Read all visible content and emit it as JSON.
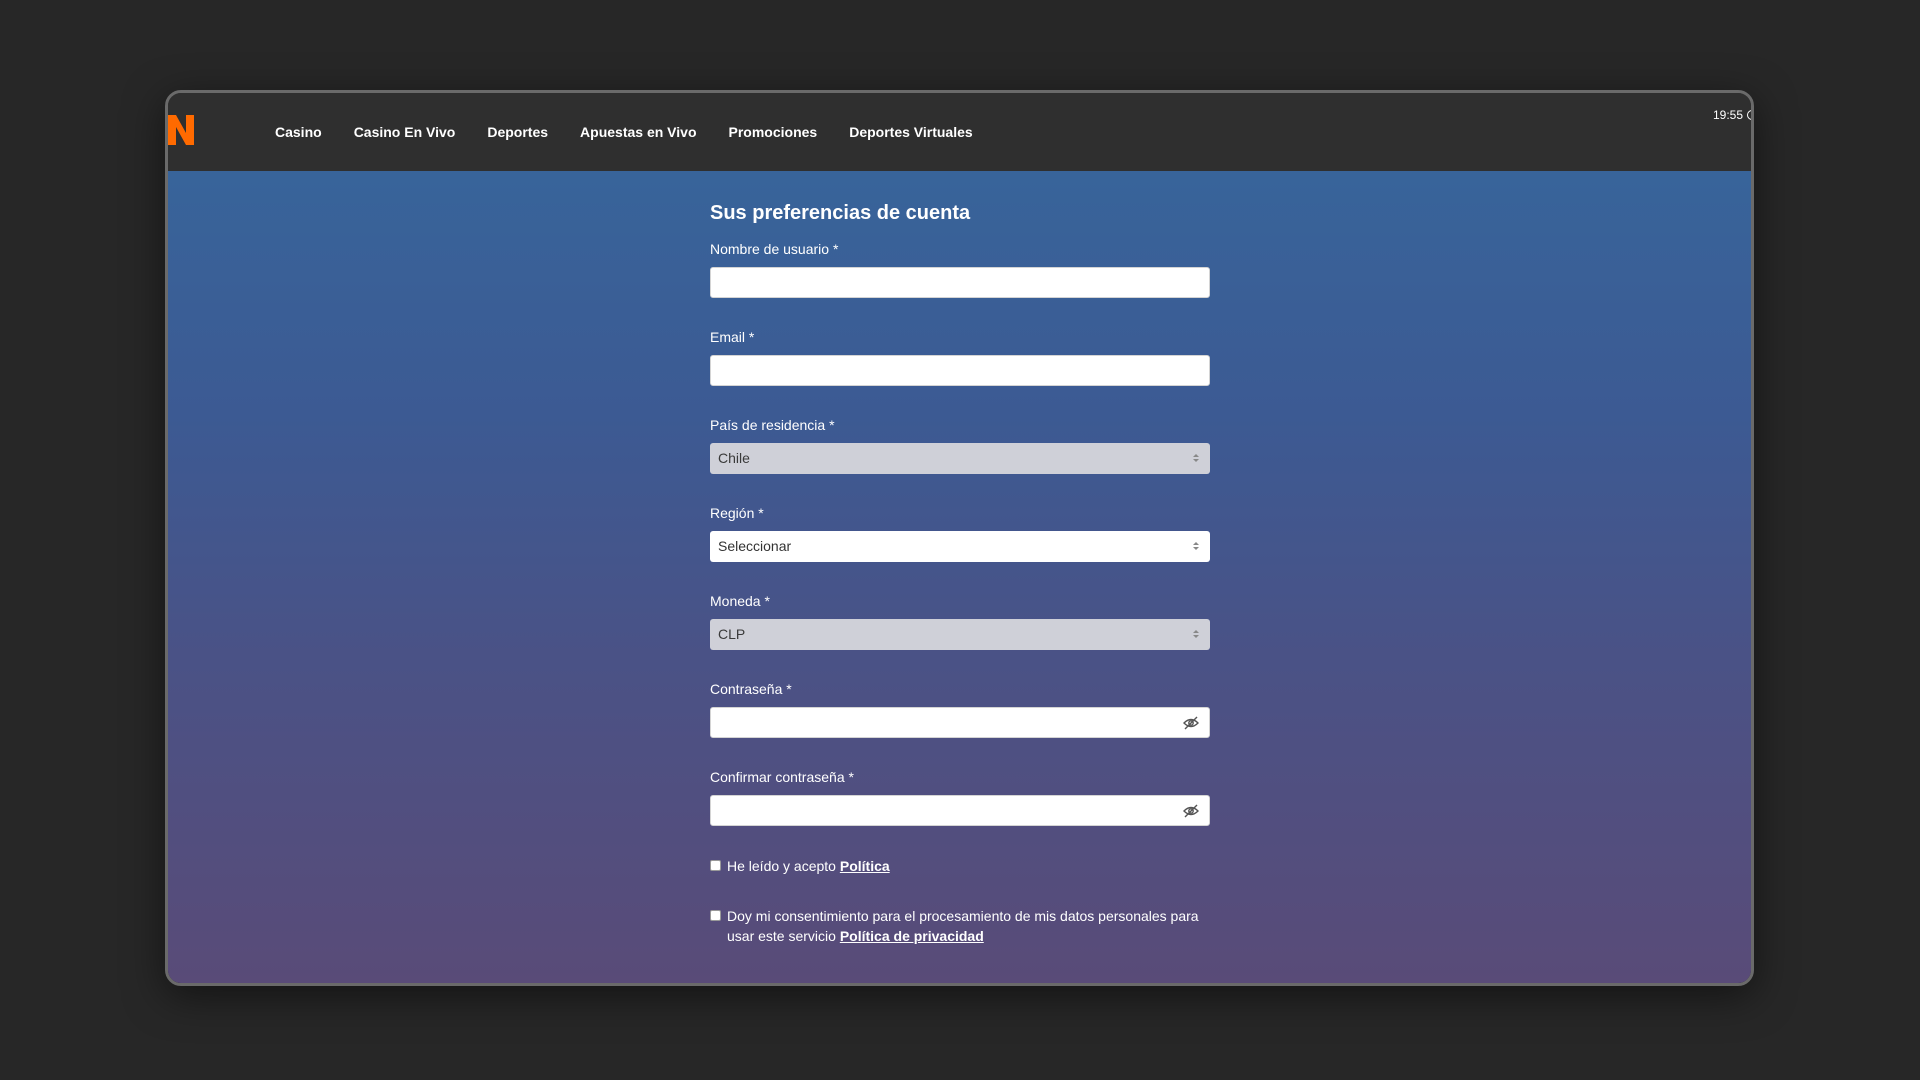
{
  "brand": {
    "logo_icon": "n-logo-icon",
    "color": "#ff6a00"
  },
  "nav": {
    "items": [
      {
        "label": "Casino"
      },
      {
        "label": "Casino En Vivo"
      },
      {
        "label": "Deportes"
      },
      {
        "label": "Apuestas en Vivo"
      },
      {
        "label": "Promociones"
      },
      {
        "label": "Deportes Virtuales"
      }
    ]
  },
  "clock": {
    "time": "19:55"
  },
  "form": {
    "title": "Sus preferencias de cuenta",
    "username": {
      "label": "Nombre de usuario *",
      "value": ""
    },
    "email": {
      "label": "Email *",
      "value": ""
    },
    "country": {
      "label": "País de residencia *",
      "value": "Chile"
    },
    "region": {
      "label": "Región *",
      "value": "Seleccionar"
    },
    "currency": {
      "label": "Moneda *",
      "value": "CLP"
    },
    "password": {
      "label": "Contraseña *",
      "value": ""
    },
    "confirm_password": {
      "label": "Confirmar contraseña *",
      "value": ""
    },
    "policy_check": {
      "text": "He leído y acepto ",
      "link": "Política",
      "checked": false
    },
    "privacy_check": {
      "text": "Doy mi consentimiento para el procesamiento de mis datos personales para usar este servicio ",
      "link": "Política de privacidad",
      "checked": false
    }
  }
}
